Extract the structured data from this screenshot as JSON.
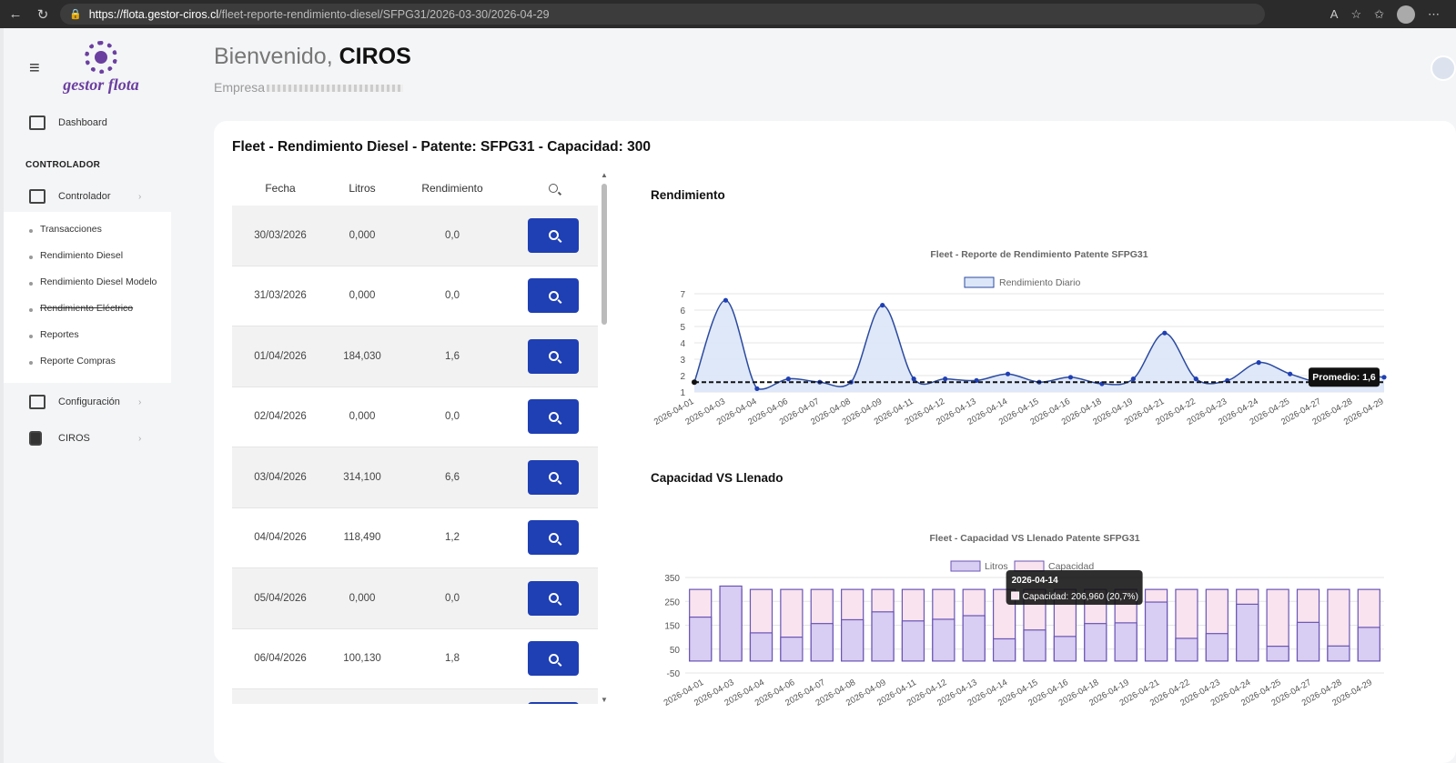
{
  "browser": {
    "url_domain": "https://flota.gestor-ciros.cl",
    "url_path": "/fleet-reporte-rendimiento-diesel/SFPG31/2026-03-30/2026-04-29"
  },
  "logo": {
    "text": "gestor flota"
  },
  "sidebar": {
    "dashboard": "Dashboard",
    "section": "CONTROLADOR",
    "controlador": "Controlador",
    "sub": [
      "Transacciones",
      "Rendimiento Diesel",
      "Rendimiento Diesel Modelo",
      "Rendimiento Eléctrico",
      "Reportes",
      "Reporte Compras"
    ],
    "configuracion": "Configuración",
    "ciros": "CIROS"
  },
  "header": {
    "greeting": "Bienvenido,",
    "user": "CIROS",
    "empresa": "Empresa"
  },
  "card": {
    "title": "Fleet - Rendimiento Diesel - Patente: SFPG31 - Capacidad: 300"
  },
  "table": {
    "headers": [
      "Fecha",
      "Litros",
      "Rendimiento"
    ],
    "rows": [
      {
        "fecha": "30/03/2026",
        "litros": "0,000",
        "rend": "0,0"
      },
      {
        "fecha": "31/03/2026",
        "litros": "0,000",
        "rend": "0,0"
      },
      {
        "fecha": "01/04/2026",
        "litros": "184,030",
        "rend": "1,6"
      },
      {
        "fecha": "02/04/2026",
        "litros": "0,000",
        "rend": "0,0"
      },
      {
        "fecha": "03/04/2026",
        "litros": "314,100",
        "rend": "6,6"
      },
      {
        "fecha": "04/04/2026",
        "litros": "118,490",
        "rend": "1,2"
      },
      {
        "fecha": "05/04/2026",
        "litros": "0,000",
        "rend": "0,0"
      },
      {
        "fecha": "06/04/2026",
        "litros": "100,130",
        "rend": "1,8"
      }
    ]
  },
  "rendimiento": {
    "section_title": "Rendimiento"
  },
  "capacidad": {
    "section_title": "Capacidad VS Llenado"
  },
  "chart_data": [
    {
      "type": "line",
      "title": "Fleet - Reporte de Rendimiento Patente SFPG31",
      "legend": [
        "Rendimiento Diario"
      ],
      "legend_position": "top",
      "categories": [
        "2026-04-01",
        "2026-04-03",
        "2026-04-04",
        "2026-04-06",
        "2026-04-07",
        "2026-04-08",
        "2026-04-09",
        "2026-04-11",
        "2026-04-12",
        "2026-04-13",
        "2026-04-14",
        "2026-04-15",
        "2026-04-16",
        "2026-04-18",
        "2026-04-19",
        "2026-04-21",
        "2026-04-22",
        "2026-04-23",
        "2026-04-24",
        "2026-04-25",
        "2026-04-27",
        "2026-04-28",
        "2026-04-29"
      ],
      "series": [
        {
          "name": "Rendimiento Diario",
          "values": [
            1.6,
            6.6,
            1.2,
            1.8,
            1.6,
            1.6,
            6.3,
            1.8,
            1.8,
            1.7,
            2.1,
            1.6,
            1.9,
            1.5,
            1.8,
            4.6,
            1.8,
            1.7,
            2.8,
            2.1,
            1.6,
            2.0,
            1.9
          ]
        }
      ],
      "ylim": [
        1,
        7
      ],
      "yticks": [
        "1",
        "2",
        "3",
        "4",
        "5",
        "6",
        "7"
      ],
      "average": {
        "value": 1.6,
        "label": "Promedio: 1,6"
      },
      "grid": true,
      "color": "#2b4a9e"
    },
    {
      "type": "bar",
      "title": "Fleet - Capacidad VS Llenado Patente SFPG31",
      "legend": [
        "Litros",
        "Capacidad"
      ],
      "legend_position": "top",
      "categories": [
        "2026-04-01",
        "2026-04-03",
        "2026-04-04",
        "2026-04-06",
        "2026-04-07",
        "2026-04-08",
        "2026-04-09",
        "2026-04-11",
        "2026-04-12",
        "2026-04-13",
        "2026-04-14",
        "2026-04-15",
        "2026-04-16",
        "2026-04-18",
        "2026-04-19",
        "2026-04-21",
        "2026-04-22",
        "2026-04-23",
        "2026-04-24",
        "2026-04-25",
        "2026-04-27",
        "2026-04-28",
        "2026-04-29"
      ],
      "series": [
        {
          "name": "Litros",
          "values": [
            184,
            314,
            118,
            100,
            157,
            173,
            206,
            168,
            175,
            190,
            93,
            130,
            103,
            157,
            160,
            247,
            95,
            115,
            238,
            62,
            162,
            63,
            141
          ]
        },
        {
          "name": "Capacidad",
          "values": [
            300,
            300,
            300,
            300,
            300,
            300,
            300,
            300,
            300,
            300,
            300,
            300,
            300,
            300,
            300,
            300,
            300,
            300,
            300,
            300,
            300,
            300,
            300
          ]
        }
      ],
      "ylim": [
        -50,
        350
      ],
      "yticks": [
        "-50",
        "50",
        "150",
        "250",
        "350"
      ],
      "tooltip": {
        "title": "2026-04-14",
        "body": "Capacidad: 206,960 (20,7%)"
      },
      "grid": true
    }
  ]
}
